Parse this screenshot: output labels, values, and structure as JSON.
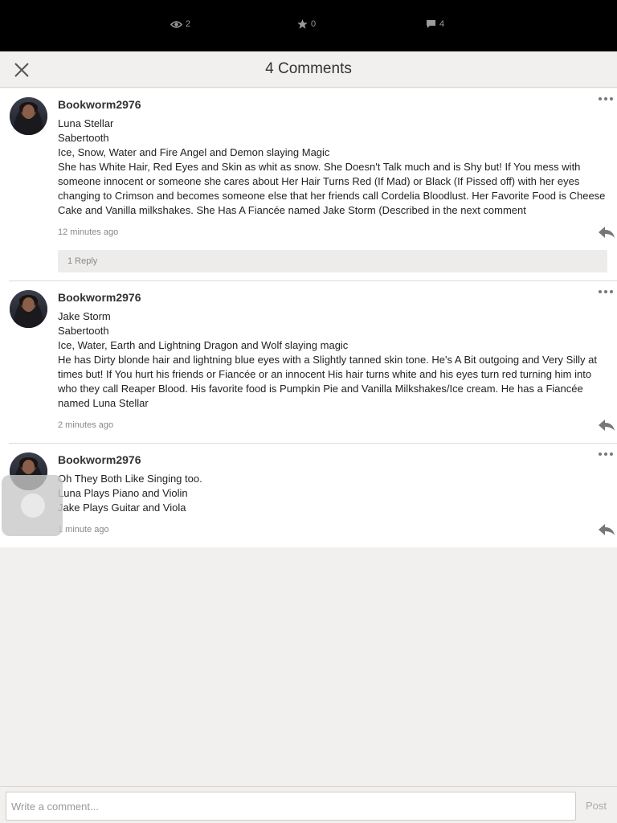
{
  "stats": {
    "views": "2",
    "votes": "0",
    "comments": "4",
    "views_icon": "eye-icon",
    "votes_icon": "star-icon",
    "comments_icon": "comment-bubble-icon"
  },
  "header": {
    "title": "4 Comments",
    "close_icon": "close-icon"
  },
  "comments": [
    {
      "author": "Bookworm2976",
      "lines": [
        "Luna Stellar",
        "Sabertooth",
        "Ice, Snow, Water and Fire Angel and Demon slaying Magic",
        "She has White Hair, Red Eyes and Skin as whit as snow. She Doesn't Talk much and is Shy but! If You mess with someone innocent or someone she cares about Her Hair Turns Red (If Mad) or Black (If Pissed off) with her eyes changing to Crimson and becomes someone else that her friends call Cordelia Bloodlust. Her Favorite Food is Cheese Cake and Vanilla milkshakes. She Has A Fiancée named Jake Storm (Described in the next comment"
      ],
      "time": "12 minutes ago",
      "replies": "1 Reply"
    },
    {
      "author": "Bookworm2976",
      "lines": [
        "Jake Storm",
        "Sabertooth",
        "Ice, Water, Earth and Lightning Dragon and Wolf slaying magic",
        "He has Dirty blonde hair and lightning blue eyes with a Slightly tanned skin tone. He's A Bit outgoing and Very Silly at times but! If You hurt his friends or Fiancée or an innocent His hair turns white and his eyes turn red turning him into who they call Reaper Blood. His favorite food is Pumpkin Pie and Vanilla Milkshakes/Ice cream. He has a Fiancée named Luna Stellar"
      ],
      "time": "2 minutes ago"
    },
    {
      "author": "Bookworm2976",
      "lines": [
        "Oh They Both Like Singing too.",
        "Luna Plays Piano and Violin",
        "Jake Plays Guitar and Viola"
      ],
      "time": "1 minute ago"
    }
  ],
  "composer": {
    "placeholder": "Write a comment...",
    "post_label": "Post"
  },
  "colors": {
    "topbar": "#000000",
    "background": "#f2f0ee",
    "card": "#ffffff",
    "muted": "#888888"
  }
}
